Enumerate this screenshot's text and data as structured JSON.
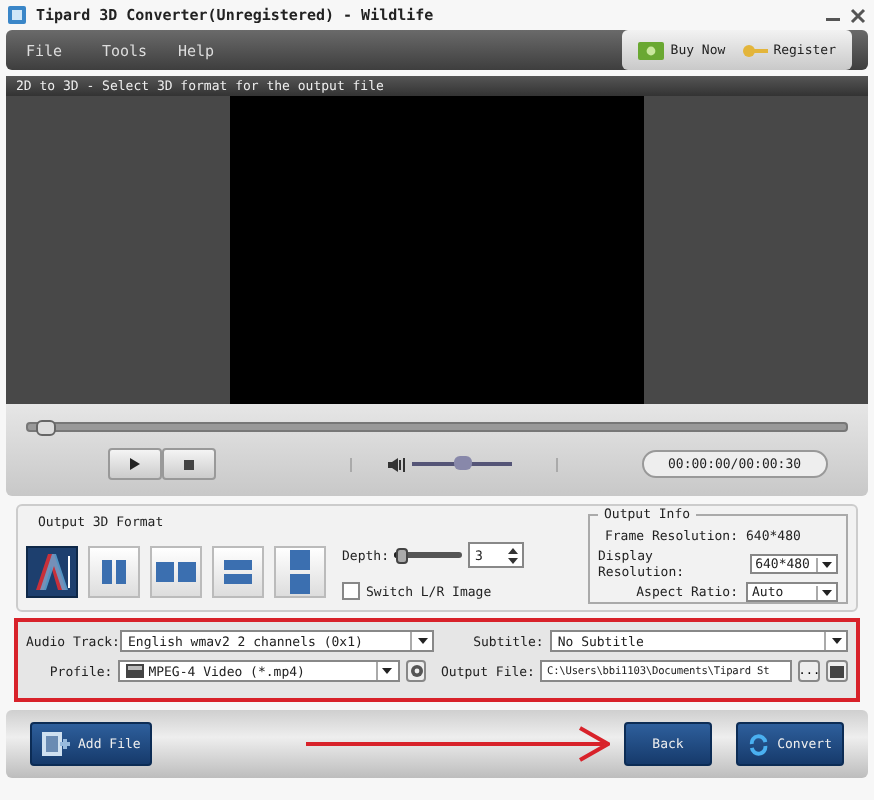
{
  "window": {
    "title": "Tipard 3D Converter(Unregistered) - Wildlife"
  },
  "menu": [
    "File",
    "Tools",
    "Help"
  ],
  "header_buttons": [
    {
      "kind": "buy",
      "label": "Buy Now"
    },
    {
      "kind": "register",
      "label": "Register"
    }
  ],
  "preview": {
    "hint": "2D to 3D - Select 3D format for the output file",
    "progress": {
      "level": 0.02
    },
    "volume": {
      "level": 0.5
    },
    "time": "00:00:00/00:00:30"
  },
  "format": {
    "title": "Output 3D Format",
    "formats": [
      {
        "kind": "anaglyph",
        "selected": true
      },
      {
        "kind": "side-half",
        "selected": false
      },
      {
        "kind": "side-full",
        "selected": false
      },
      {
        "kind": "top-half",
        "selected": false
      },
      {
        "kind": "top-full",
        "selected": false
      }
    ],
    "depth_label": "Depth:",
    "depth": {
      "level": 0.08
    },
    "depth_value": "3",
    "switch": {
      "label": "Switch L/R Image",
      "checked": false
    }
  },
  "output_info": {
    "title": "Output Info",
    "frame_label": "Frame Resolution:",
    "frame_value": "640*480",
    "display_label": "Display Resolution:",
    "display_value": "640*480",
    "aspect_label": "Aspect Ratio:",
    "aspect_value": "Auto"
  },
  "settings": {
    "audio_label": "Audio Track:",
    "audio_value": "English wmav2 2 channels (0x1)",
    "subtitle_label": "Subtitle:",
    "subtitle_value": "No Subtitle",
    "profile_label": "Profile:",
    "profile_value": "MPEG-4 Video (*.mp4)",
    "output_label": "Output File:",
    "output_value": "C:\\Users\\bbi1103\\Documents\\Tipard St",
    "browse": "..."
  },
  "actions": {
    "add_file": "Add File",
    "back": "Back",
    "convert": "Convert"
  }
}
